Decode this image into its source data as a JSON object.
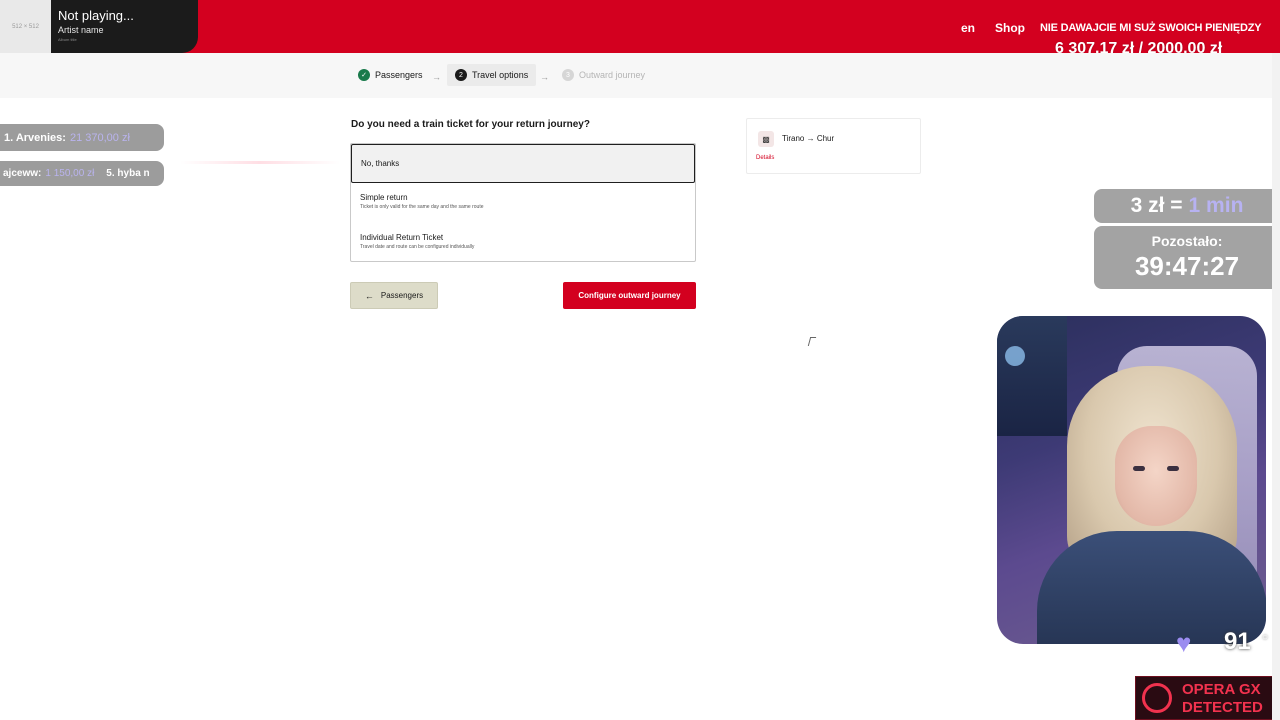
{
  "header": {
    "lang": "en",
    "shop": "Shop",
    "donate_text": "NIE DAWAJCIE MI SUŻ SWOICH PIENIĘDZY",
    "goal_text": "6 307,17 zł / 2000,00 zł",
    "goal_fill": 1.0
  },
  "music": {
    "art_text": "512 × 512",
    "title": "Not playing...",
    "artist": "Artist name",
    "album": "Album title"
  },
  "stepper": {
    "steps": [
      {
        "num": "✓",
        "label": "Passengers"
      },
      {
        "num": "2",
        "label": "Travel options"
      },
      {
        "num": "3",
        "label": "Outward journey"
      }
    ],
    "arrow": "→"
  },
  "form": {
    "question": "Do you need a train ticket for your return journey?",
    "selected_option": "No, thanks",
    "options": [
      {
        "label": "Simple return",
        "desc": "Ticket is only valid for the same day and the same route"
      },
      {
        "label": "Individual Return Ticket",
        "desc": "Travel date and route can be configured individually"
      }
    ],
    "back_label": "Passengers",
    "back_icon": "←",
    "next_label": "Configure outward journey"
  },
  "summary": {
    "route": "Tirano → Chur",
    "details": "Details",
    "icon": "train-icon"
  },
  "leaderboard": {
    "first": {
      "name": "1. Arvenies:",
      "amount": "21 370,00 zł"
    },
    "second": {
      "name": "ajceww:",
      "amount": "1 150,00 zł",
      "next": "5. hyba n"
    }
  },
  "overlay": {
    "rate_left": "3 zł =",
    "rate_right": "1 min",
    "remaining_label": "Pozostało:",
    "remaining_time": "39:47:27",
    "heart_rate": "91",
    "heart_icon": "♥",
    "opera_line1": "OPERA GX",
    "opera_line2": "DETECTED"
  },
  "colors": {
    "brand_red": "#d3001f",
    "accent_purple": "#b7b2f2",
    "success_green": "#197a4b"
  }
}
